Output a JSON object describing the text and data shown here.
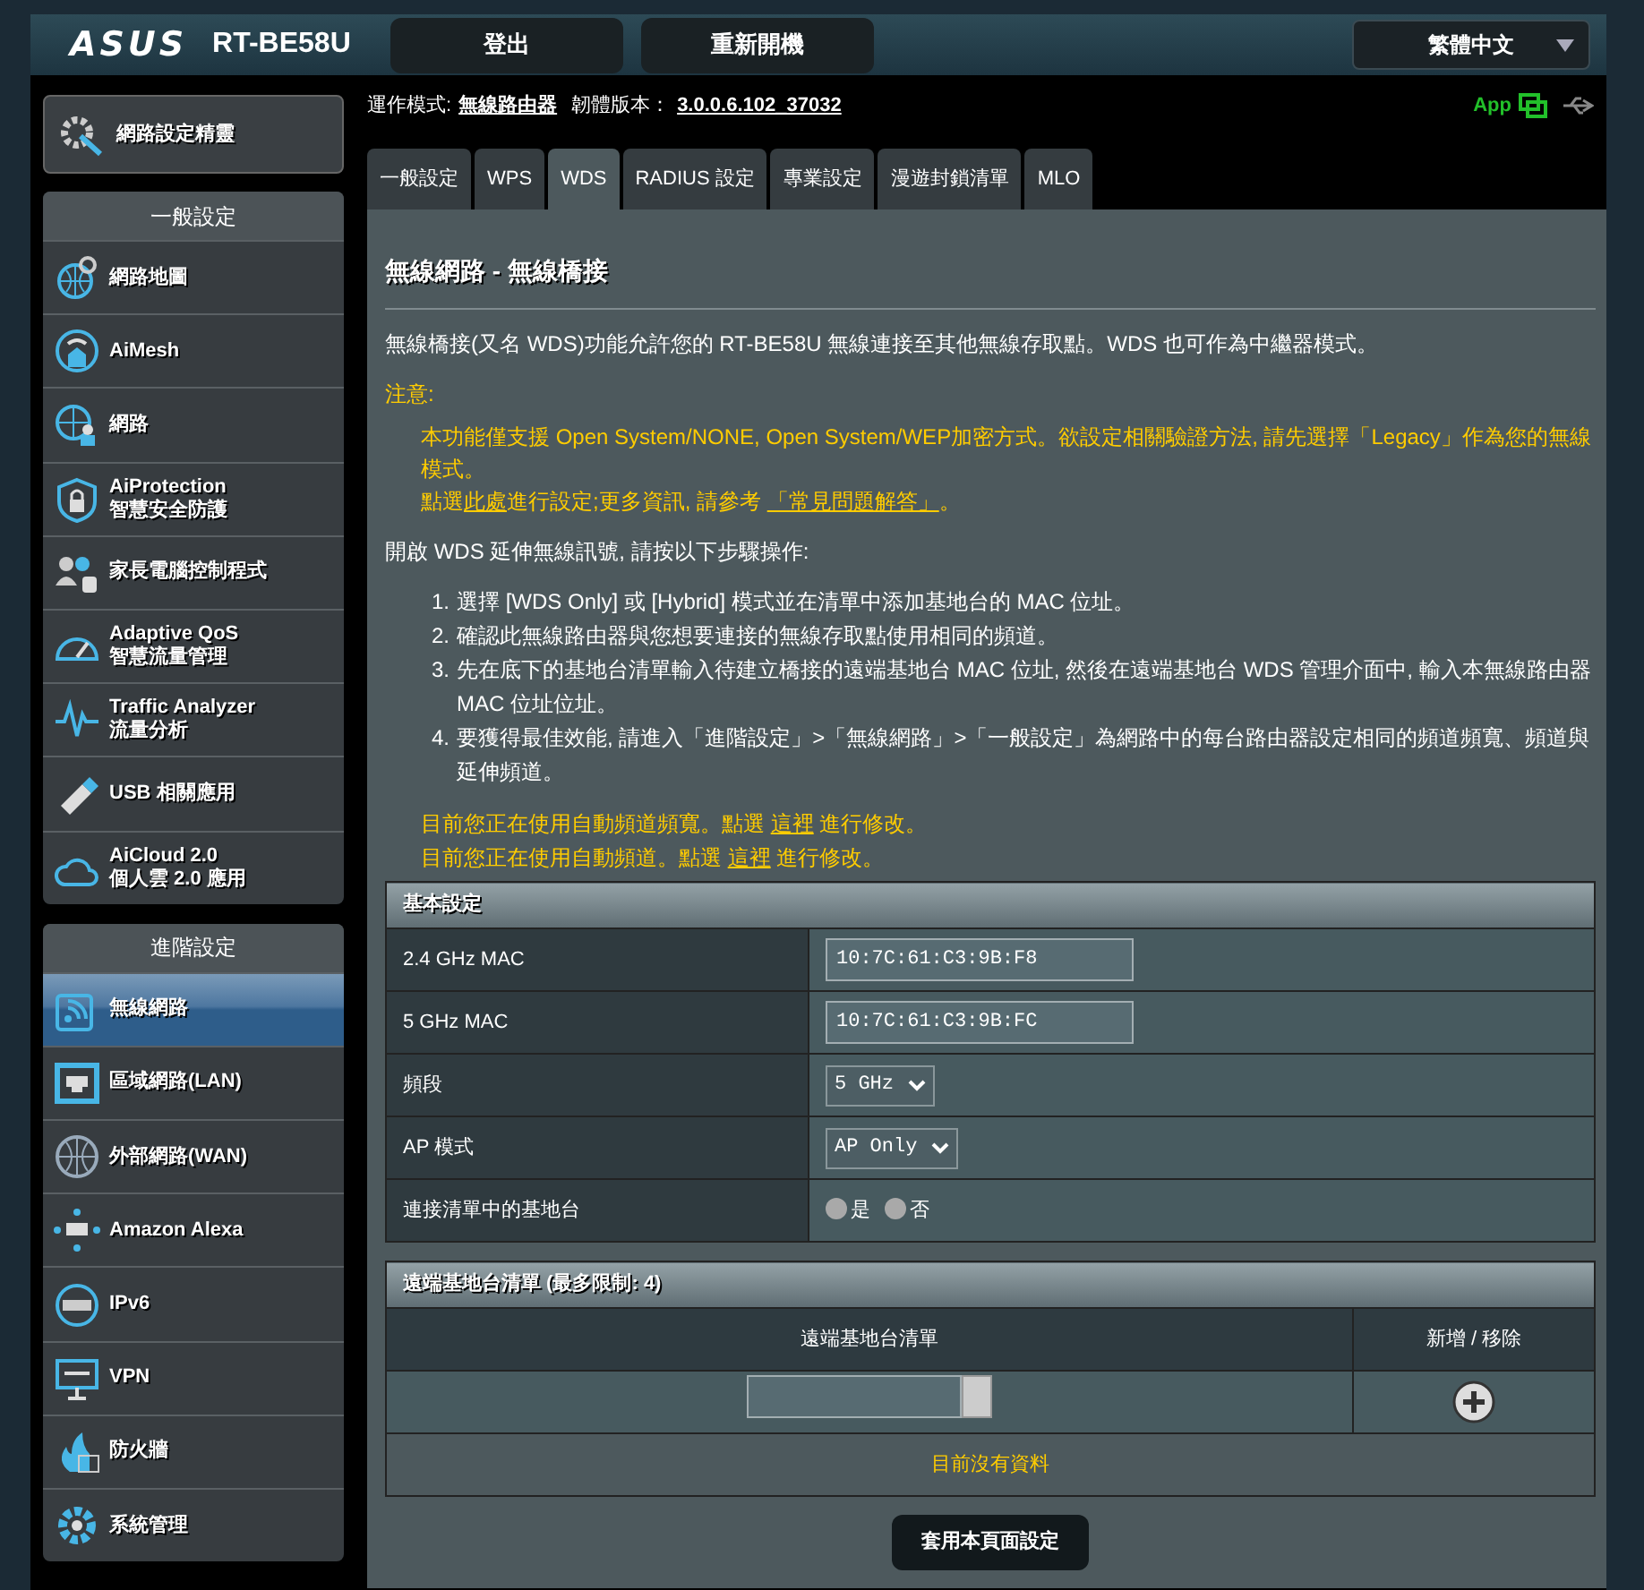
{
  "header": {
    "logo": "ASUS",
    "model": "RT-BE58U",
    "buttons": [
      "登出",
      "重新開機"
    ],
    "language": "繁體中文"
  },
  "quick_setup": {
    "label": "網路設定精靈"
  },
  "sidebar": [
    {
      "title": "一般設定",
      "items": [
        {
          "label": "網路地圖",
          "selected": false
        },
        {
          "label": "AiMesh",
          "selected": false
        },
        {
          "label": "網路",
          "selected": false
        },
        {
          "label": "AiProtection",
          "sublabel": "智慧安全防護",
          "selected": false
        },
        {
          "label": "家長電腦控制程式",
          "selected": false
        },
        {
          "label": "Adaptive QoS",
          "sublabel": "智慧流量管理",
          "selected": false
        },
        {
          "label": "Traffic Analyzer",
          "sublabel": "流量分析",
          "selected": false
        },
        {
          "label": "USB 相關應用",
          "selected": false
        },
        {
          "label": "AiCloud 2.0",
          "sublabel": "個人雲 2.0 應用",
          "selected": false
        }
      ]
    },
    {
      "title": "進階設定",
      "items": [
        {
          "label": "無線網路",
          "selected": true
        },
        {
          "label": "區域網路(LAN)",
          "selected": false
        },
        {
          "label": "外部網路(WAN)",
          "selected": false
        },
        {
          "label": "Amazon Alexa",
          "selected": false
        },
        {
          "label": "IPv6",
          "selected": false
        },
        {
          "label": "VPN",
          "selected": false
        },
        {
          "label": "防火牆",
          "selected": false
        },
        {
          "label": "系統管理",
          "selected": false
        }
      ]
    }
  ],
  "status_line": {
    "mode_label": "運作模式:",
    "mode_value": "無線路由器",
    "firmware_label": "韌體版本：",
    "firmware_value": "3.0.0.6.102_37032",
    "app": "App"
  },
  "tabs": [
    {
      "label": "一般設定",
      "selected": false
    },
    {
      "label": "WPS",
      "selected": false
    },
    {
      "label": "WDS",
      "selected": true
    },
    {
      "label": "RADIUS 設定",
      "selected": false
    },
    {
      "label": "專業設定",
      "selected": false
    },
    {
      "label": "漫遊封鎖清單",
      "selected": false
    },
    {
      "label": "MLO",
      "selected": false
    }
  ],
  "content": {
    "title": "無線網路 - 無線橋接",
    "intro": "無線橋接(又名 WDS)功能允許您的 RT-BE58U 無線連接至其他無線存取點。WDS 也可作為中繼器模式。",
    "note_label": "注意:",
    "notes": [
      [
        {
          "text": "本功能僅支援 Open System/NONE, Open System/WEP加密方式。欲設定相關驗證方法, 請先選擇「Legacy」作為您的無線模式。"
        }
      ],
      [
        {
          "text": "點選"
        },
        {
          "text": "此處",
          "link": true
        },
        {
          "text": "進行設定;更多資訊, 請參考 "
        },
        {
          "text": "「常見問題解答」",
          "link": true
        },
        {
          "text": "。"
        }
      ]
    ],
    "steps_intro": "開啟 WDS 延伸無線訊號, 請按以下步驟操作:",
    "steps": [
      {
        "number": "1.",
        "text": "選擇 [WDS Only] 或 [Hybrid] 模式並在清單中添加基地台的 MAC 位址。"
      },
      {
        "number": "2.",
        "text": "確認此無線路由器與您想要連接的無線存取點使用相同的頻道。"
      },
      {
        "number": "3.",
        "text": "先在底下的基地台清單輸入待建立橋接的遠端基地台 MAC 位址, 然後在遠端基地台 WDS 管理介面中, 輸入本無線路由器 MAC 位址位址。"
      },
      {
        "number": "4.",
        "text": "要獲得最佳效能, 請進入「進階設定」>「無線網路」>「一般設定」為網路中的每台路由器設定相同的頻道頻寬、頻道與延伸頻道。"
      }
    ],
    "notices": [
      [
        {
          "text": "目前您正在使用自動頻道頻寬。點選 "
        },
        {
          "text": "這裡",
          "link": true
        },
        {
          "text": " 進行修改。"
        }
      ],
      [
        {
          "text": "目前您正在使用自動頻道。點選 "
        },
        {
          "text": "這裡",
          "link": true
        },
        {
          "text": " 進行修改。"
        }
      ]
    ]
  },
  "basic_settings": {
    "title": "基本設定",
    "rows": [
      {
        "kind": "text",
        "label": "2.4 GHz MAC",
        "value": "10:7C:61:C3:9B:F8"
      },
      {
        "kind": "text",
        "label": "5 GHz MAC",
        "value": "10:7C:61:C3:9B:FC"
      },
      {
        "kind": "select",
        "label": "頻段",
        "value": "5 GHz"
      },
      {
        "kind": "select",
        "label": "AP 模式",
        "value": "AP Only"
      },
      {
        "kind": "radio",
        "label": "連接清單中的基地台",
        "options": [
          {
            "label": "是",
            "selected": false
          },
          {
            "label": "否",
            "selected": false
          }
        ]
      }
    ]
  },
  "remote_list": {
    "title": "遠端基地台清單 (最多限制: 4)",
    "columns": [
      "遠端基地台清單",
      "新增 / 移除"
    ],
    "empty_message": "目前沒有資料"
  },
  "apply_button": "套用本頁面設定"
}
